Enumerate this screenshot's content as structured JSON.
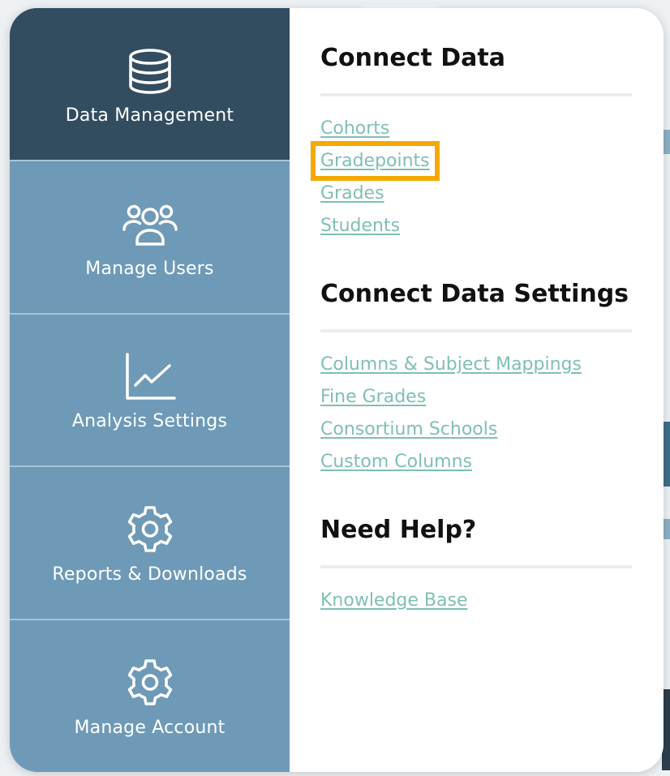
{
  "sidebar": {
    "items": [
      {
        "label": "Data Management",
        "icon": "database-icon",
        "active": true
      },
      {
        "label": "Manage Users",
        "icon": "users-icon",
        "active": false
      },
      {
        "label": "Analysis Settings",
        "icon": "line-chart-icon",
        "active": false
      },
      {
        "label": "Reports & Downloads",
        "icon": "gear-icon",
        "active": false
      },
      {
        "label": "Manage Account",
        "icon": "gear-icon",
        "active": false
      }
    ]
  },
  "panel": {
    "sections": [
      {
        "title": "Connect Data",
        "links": [
          "Cohorts",
          "Gradepoints",
          "Grades",
          "Students"
        ]
      },
      {
        "title": "Connect Data Settings",
        "links": [
          "Columns & Subject Mappings",
          "Fine Grades",
          "Consortium Schools",
          "Custom Columns"
        ]
      },
      {
        "title": "Need Help?",
        "links": [
          "Knowledge Base"
        ]
      }
    ],
    "highlighted_link": "Gradepoints"
  },
  "colors": {
    "sidebar_active": "#324c60",
    "sidebar_bg": "#6e9ab7",
    "link": "#7fbfb4",
    "highlight": "#f5a800"
  }
}
